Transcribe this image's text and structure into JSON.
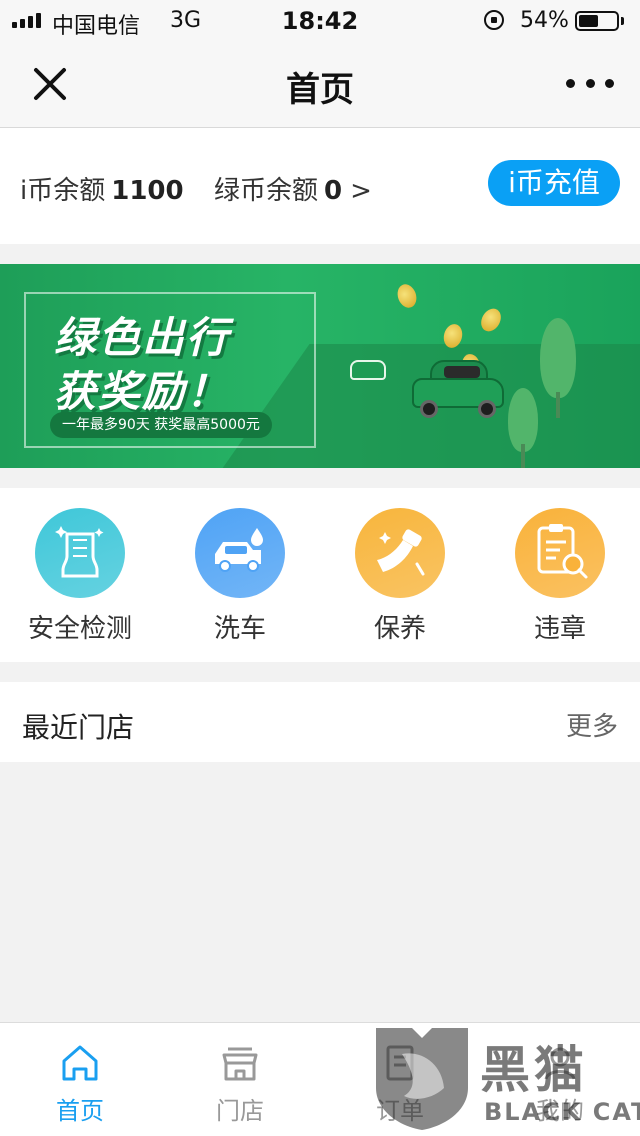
{
  "status_bar": {
    "carrier": "中国电信",
    "network": "3G",
    "time": "18:42",
    "battery_percent": "54%",
    "battery_level": 0.54
  },
  "nav": {
    "title": "首页",
    "close_icon": "close-icon",
    "more_icon": "more-icon"
  },
  "balance": {
    "icoin_label": "i币余额",
    "icoin_value": "1100",
    "green_label": "绿币余额",
    "green_value": "0",
    "green_arrow": ">",
    "recharge_label": "i币充值",
    "recharge_color": "#0aa0f5"
  },
  "banner": {
    "title_line1": "绿色出行",
    "title_line2": "获奖励！",
    "subtitle": "一年最多90天 获奖最高5000元",
    "color": "#23ad60"
  },
  "services": [
    {
      "label": "安全检测",
      "icon": "car-seat-icon",
      "color": "#3fc7d9"
    },
    {
      "label": "洗车",
      "icon": "car-wash-icon",
      "color": "#4fa3f5"
    },
    {
      "label": "保养",
      "icon": "maintenance-spray-icon",
      "color": "#f8b53c"
    },
    {
      "label": "违章",
      "icon": "violation-search-icon",
      "color": "#f9b23a"
    }
  ],
  "stores": {
    "title": "最近门店",
    "more": "更多"
  },
  "tabs": [
    {
      "label": "首页",
      "icon": "home-icon",
      "active": true
    },
    {
      "label": "门店",
      "icon": "store-icon",
      "active": false
    },
    {
      "label": "订单",
      "icon": "order-icon",
      "active": false
    },
    {
      "label": "我的",
      "icon": "profile-icon",
      "active": false
    }
  ],
  "watermark": {
    "text": "黑猫",
    "sub": "BLACK CAT"
  },
  "colors": {
    "accent": "#1a9ff0",
    "tab_inactive": "#999999"
  }
}
